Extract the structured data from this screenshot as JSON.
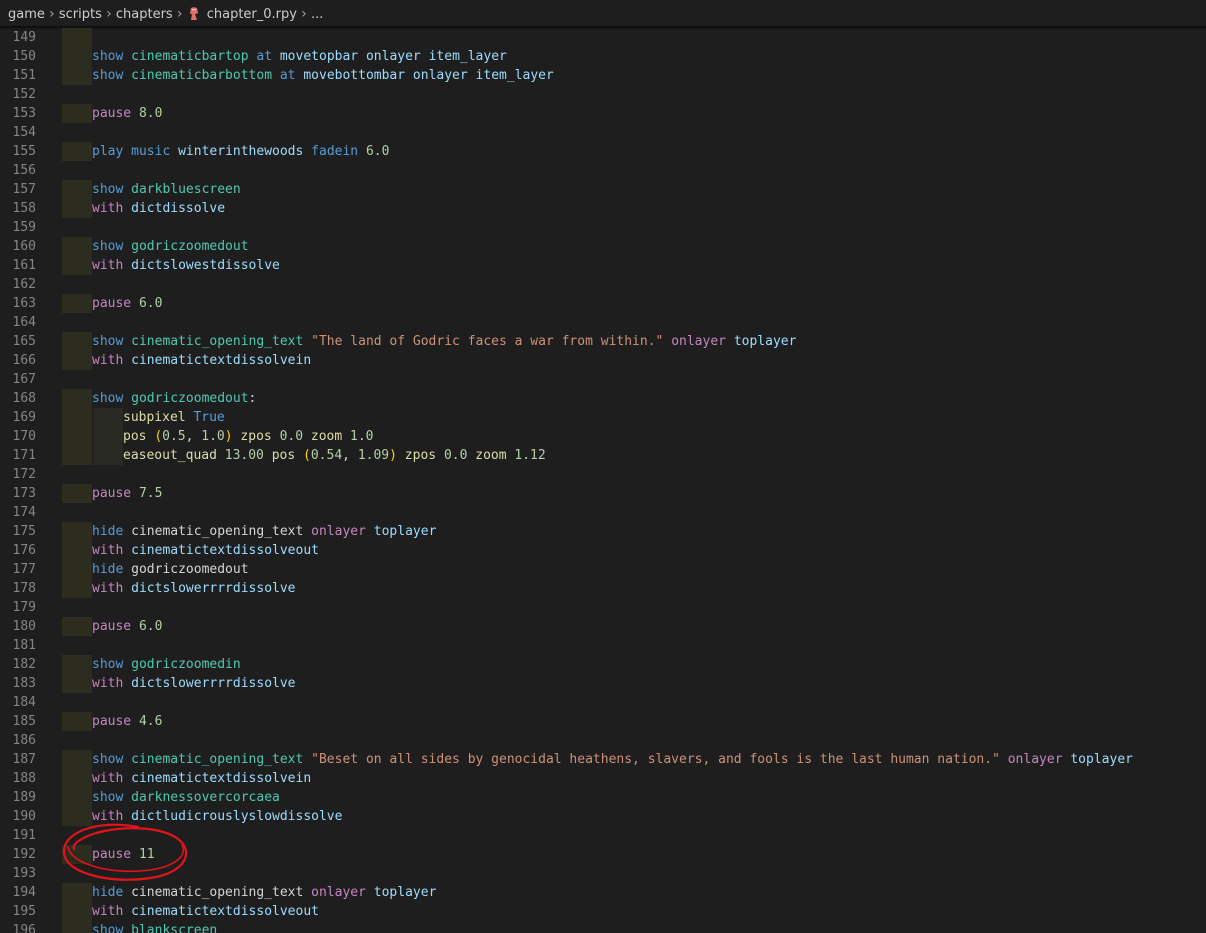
{
  "breadcrumb": {
    "items": [
      "game",
      "scripts",
      "chapters",
      "chapter_0.rpy",
      "..."
    ],
    "separator": "›"
  },
  "file_icon_color": "#e06c6c",
  "annotation_color": "#e0141a",
  "lines": [
    {
      "n": "149",
      "guide": true,
      "tokens": []
    },
    {
      "n": "150",
      "guide": true,
      "tokens": [
        [
          "kw",
          "show"
        ],
        [
          "sp",
          " "
        ],
        [
          "id",
          "cinematicbartop"
        ],
        [
          "sp",
          " "
        ],
        [
          "kw",
          "at"
        ],
        [
          "sp",
          " "
        ],
        [
          "var",
          "movetopbar"
        ],
        [
          "sp",
          " "
        ],
        [
          "var",
          "onlayer"
        ],
        [
          "sp",
          " "
        ],
        [
          "var",
          "item_layer"
        ]
      ]
    },
    {
      "n": "151",
      "guide": true,
      "tokens": [
        [
          "kw",
          "show"
        ],
        [
          "sp",
          " "
        ],
        [
          "id",
          "cinematicbarbottom"
        ],
        [
          "sp",
          " "
        ],
        [
          "kw",
          "at"
        ],
        [
          "sp",
          " "
        ],
        [
          "var",
          "movebottombar"
        ],
        [
          "sp",
          " "
        ],
        [
          "var",
          "onlayer"
        ],
        [
          "sp",
          " "
        ],
        [
          "var",
          "item_layer"
        ]
      ]
    },
    {
      "n": "152",
      "guide": false,
      "tokens": []
    },
    {
      "n": "153",
      "guide": true,
      "tokens": [
        [
          "pink",
          "pause"
        ],
        [
          "sp",
          " "
        ],
        [
          "num",
          "8.0"
        ]
      ]
    },
    {
      "n": "154",
      "guide": false,
      "tokens": []
    },
    {
      "n": "155",
      "guide": true,
      "tokens": [
        [
          "kw",
          "play"
        ],
        [
          "sp",
          " "
        ],
        [
          "kw",
          "music"
        ],
        [
          "sp",
          " "
        ],
        [
          "var",
          "winterinthewoods"
        ],
        [
          "sp",
          " "
        ],
        [
          "kw",
          "fadein"
        ],
        [
          "sp",
          " "
        ],
        [
          "num",
          "6.0"
        ]
      ]
    },
    {
      "n": "156",
      "guide": false,
      "tokens": []
    },
    {
      "n": "157",
      "guide": true,
      "tokens": [
        [
          "kw",
          "show"
        ],
        [
          "sp",
          " "
        ],
        [
          "id",
          "darkbluescreen"
        ]
      ]
    },
    {
      "n": "158",
      "guide": true,
      "tokens": [
        [
          "pink",
          "with"
        ],
        [
          "sp",
          " "
        ],
        [
          "var",
          "dictdissolve"
        ]
      ]
    },
    {
      "n": "159",
      "guide": false,
      "tokens": []
    },
    {
      "n": "160",
      "guide": true,
      "tokens": [
        [
          "kw",
          "show"
        ],
        [
          "sp",
          " "
        ],
        [
          "id",
          "godriczoomedout"
        ]
      ]
    },
    {
      "n": "161",
      "guide": true,
      "tokens": [
        [
          "pink",
          "with"
        ],
        [
          "sp",
          " "
        ],
        [
          "var",
          "dictslowestdissolve"
        ]
      ]
    },
    {
      "n": "162",
      "guide": false,
      "tokens": []
    },
    {
      "n": "163",
      "guide": true,
      "tokens": [
        [
          "pink",
          "pause"
        ],
        [
          "sp",
          " "
        ],
        [
          "num",
          "6.0"
        ]
      ]
    },
    {
      "n": "164",
      "guide": false,
      "tokens": []
    },
    {
      "n": "165",
      "guide": true,
      "tokens": [
        [
          "kw",
          "show"
        ],
        [
          "sp",
          " "
        ],
        [
          "id",
          "cinematic_opening_text"
        ],
        [
          "sp",
          " "
        ],
        [
          "str",
          "\"The land of Godric faces a war from within.\""
        ],
        [
          "sp",
          " "
        ],
        [
          "pink",
          "onlayer"
        ],
        [
          "sp",
          " "
        ],
        [
          "var",
          "toplayer"
        ]
      ]
    },
    {
      "n": "166",
      "guide": true,
      "tokens": [
        [
          "pink",
          "with"
        ],
        [
          "sp",
          " "
        ],
        [
          "var",
          "cinematictextdissolvein"
        ]
      ]
    },
    {
      "n": "167",
      "guide": false,
      "tokens": []
    },
    {
      "n": "168",
      "guide": true,
      "tokens": [
        [
          "kw",
          "show"
        ],
        [
          "sp",
          " "
        ],
        [
          "id",
          "godriczoomedout"
        ],
        [
          "plain",
          ":"
        ]
      ]
    },
    {
      "n": "169",
      "guide": true,
      "guide2": true,
      "indent": 2,
      "tokens": [
        [
          "yel",
          "subpixel"
        ],
        [
          "sp",
          " "
        ],
        [
          "kw",
          "True"
        ]
      ]
    },
    {
      "n": "170",
      "guide": true,
      "guide2": true,
      "indent": 2,
      "tokens": [
        [
          "yel",
          "pos"
        ],
        [
          "sp",
          " "
        ],
        [
          "paren",
          "("
        ],
        [
          "num",
          "0.5"
        ],
        [
          "plain",
          ", "
        ],
        [
          "num",
          "1.0"
        ],
        [
          "paren",
          ")"
        ],
        [
          "sp",
          " "
        ],
        [
          "yel",
          "zpos"
        ],
        [
          "sp",
          " "
        ],
        [
          "num",
          "0.0"
        ],
        [
          "sp",
          " "
        ],
        [
          "yel",
          "zoom"
        ],
        [
          "sp",
          " "
        ],
        [
          "num",
          "1.0"
        ]
      ]
    },
    {
      "n": "171",
      "guide": true,
      "guide2": true,
      "indent": 2,
      "tokens": [
        [
          "yel",
          "easeout_quad"
        ],
        [
          "sp",
          " "
        ],
        [
          "num",
          "13.00"
        ],
        [
          "sp",
          " "
        ],
        [
          "yel",
          "pos"
        ],
        [
          "sp",
          " "
        ],
        [
          "paren",
          "("
        ],
        [
          "num",
          "0.54"
        ],
        [
          "plain",
          ", "
        ],
        [
          "num",
          "1.09"
        ],
        [
          "paren",
          ")"
        ],
        [
          "sp",
          " "
        ],
        [
          "yel",
          "zpos"
        ],
        [
          "sp",
          " "
        ],
        [
          "num",
          "0.0"
        ],
        [
          "sp",
          " "
        ],
        [
          "yel",
          "zoom"
        ],
        [
          "sp",
          " "
        ],
        [
          "num",
          "1.12"
        ]
      ]
    },
    {
      "n": "172",
      "guide": false,
      "tokens": []
    },
    {
      "n": "173",
      "guide": true,
      "tokens": [
        [
          "pink",
          "pause"
        ],
        [
          "sp",
          " "
        ],
        [
          "num",
          "7.5"
        ]
      ]
    },
    {
      "n": "174",
      "guide": false,
      "tokens": []
    },
    {
      "n": "175",
      "guide": true,
      "tokens": [
        [
          "kw",
          "hide"
        ],
        [
          "sp",
          " "
        ],
        [
          "plain",
          "cinematic_opening_text"
        ],
        [
          "sp",
          " "
        ],
        [
          "pink",
          "onlayer"
        ],
        [
          "sp",
          " "
        ],
        [
          "var",
          "toplayer"
        ]
      ]
    },
    {
      "n": "176",
      "guide": true,
      "tokens": [
        [
          "pink",
          "with"
        ],
        [
          "sp",
          " "
        ],
        [
          "var",
          "cinematictextdissolveout"
        ]
      ]
    },
    {
      "n": "177",
      "guide": true,
      "tokens": [
        [
          "kw",
          "hide"
        ],
        [
          "sp",
          " "
        ],
        [
          "plain",
          "godriczoomedout"
        ]
      ]
    },
    {
      "n": "178",
      "guide": true,
      "tokens": [
        [
          "pink",
          "with"
        ],
        [
          "sp",
          " "
        ],
        [
          "var",
          "dictslowerrrrdissolve"
        ]
      ]
    },
    {
      "n": "179",
      "guide": false,
      "tokens": []
    },
    {
      "n": "180",
      "guide": true,
      "tokens": [
        [
          "pink",
          "pause"
        ],
        [
          "sp",
          " "
        ],
        [
          "num",
          "6.0"
        ]
      ]
    },
    {
      "n": "181",
      "guide": false,
      "tokens": []
    },
    {
      "n": "182",
      "guide": true,
      "tokens": [
        [
          "kw",
          "show"
        ],
        [
          "sp",
          " "
        ],
        [
          "id",
          "godriczoomedin"
        ]
      ]
    },
    {
      "n": "183",
      "guide": true,
      "tokens": [
        [
          "pink",
          "with"
        ],
        [
          "sp",
          " "
        ],
        [
          "var",
          "dictslowerrrrdissolve"
        ]
      ]
    },
    {
      "n": "184",
      "guide": false,
      "tokens": []
    },
    {
      "n": "185",
      "guide": true,
      "tokens": [
        [
          "pink",
          "pause"
        ],
        [
          "sp",
          " "
        ],
        [
          "num",
          "4.6"
        ]
      ]
    },
    {
      "n": "186",
      "guide": false,
      "tokens": []
    },
    {
      "n": "187",
      "guide": true,
      "tokens": [
        [
          "kw",
          "show"
        ],
        [
          "sp",
          " "
        ],
        [
          "id",
          "cinematic_opening_text"
        ],
        [
          "sp",
          " "
        ],
        [
          "str",
          "\"Beset on all sides by genocidal heathens, slavers, and fools is the last human nation.\""
        ],
        [
          "sp",
          " "
        ],
        [
          "pink",
          "onlayer"
        ],
        [
          "sp",
          " "
        ],
        [
          "var",
          "toplayer"
        ]
      ]
    },
    {
      "n": "188",
      "guide": true,
      "tokens": [
        [
          "pink",
          "with"
        ],
        [
          "sp",
          " "
        ],
        [
          "var",
          "cinematictextdissolvein"
        ]
      ]
    },
    {
      "n": "189",
      "guide": true,
      "tokens": [
        [
          "kw",
          "show"
        ],
        [
          "sp",
          " "
        ],
        [
          "id",
          "darknessovercorcaea"
        ]
      ]
    },
    {
      "n": "190",
      "guide": true,
      "tokens": [
        [
          "pink",
          "with"
        ],
        [
          "sp",
          " "
        ],
        [
          "var",
          "dictludicrouslyslowdissolve"
        ]
      ]
    },
    {
      "n": "191",
      "guide": false,
      "tokens": []
    },
    {
      "n": "192",
      "guide": true,
      "tokens": [
        [
          "pink",
          "pause"
        ],
        [
          "sp",
          " "
        ],
        [
          "num",
          "11"
        ]
      ]
    },
    {
      "n": "193",
      "guide": false,
      "tokens": []
    },
    {
      "n": "194",
      "guide": true,
      "tokens": [
        [
          "kw",
          "hide"
        ],
        [
          "sp",
          " "
        ],
        [
          "plain",
          "cinematic_opening_text"
        ],
        [
          "sp",
          " "
        ],
        [
          "pink",
          "onlayer"
        ],
        [
          "sp",
          " "
        ],
        [
          "var",
          "toplayer"
        ]
      ]
    },
    {
      "n": "195",
      "guide": true,
      "tokens": [
        [
          "pink",
          "with"
        ],
        [
          "sp",
          " "
        ],
        [
          "var",
          "cinematictextdissolveout"
        ]
      ]
    },
    {
      "n": "196",
      "guide": true,
      "tokens": [
        [
          "kw",
          "show"
        ],
        [
          "sp",
          " "
        ],
        [
          "id",
          "blankscreen"
        ]
      ]
    }
  ]
}
